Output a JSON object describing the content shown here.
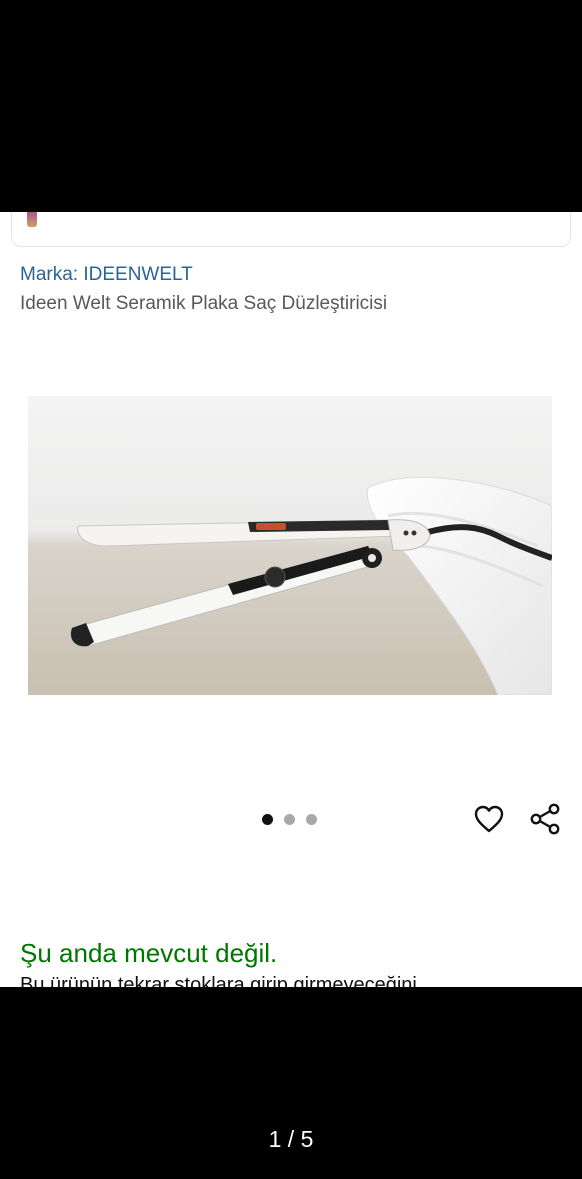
{
  "product": {
    "brand": "Marka: IDEENWELT",
    "title": "Ideen Welt Seramik Plaka Saç Düzleştiricisi",
    "image_alt": "Ideen Welt Seramik Plaka Saç Düzleştiricisi"
  },
  "carousel": {
    "dot_count": 3,
    "active_index": 0
  },
  "actions": {
    "favorite_icon": "heart-icon",
    "share_icon": "share-icon"
  },
  "availability": {
    "status": "Şu anda mevcut değil.",
    "notice_partial": "Bu ürünün tekrar stoklara girip girmeyeceğini"
  },
  "viewer": {
    "page_counter": "1 / 5"
  },
  "colors": {
    "brand_link": "#2a6496",
    "title": "#565959",
    "availability": "#007600"
  }
}
